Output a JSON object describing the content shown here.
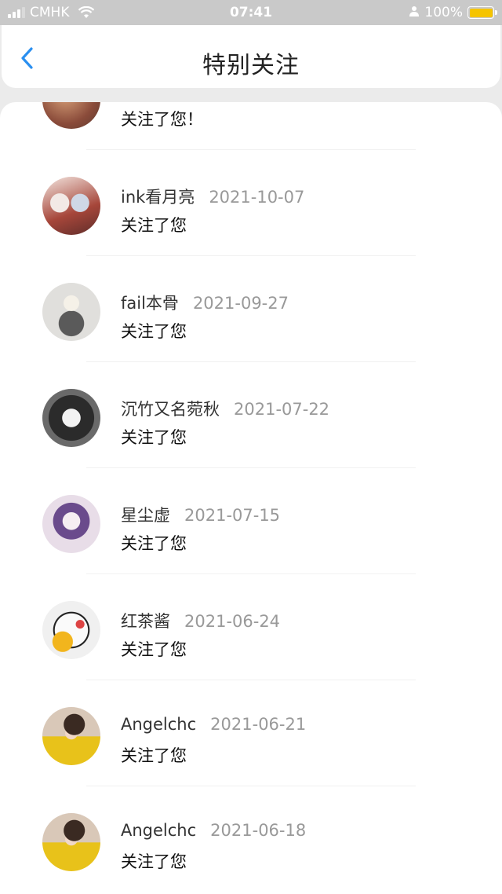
{
  "status_bar": {
    "carrier": "CMHK",
    "time": "07:41",
    "battery": "100%",
    "battery_color": "#f5c400"
  },
  "header": {
    "title": "特别关注",
    "back_icon": "chevron-left-icon",
    "accent": "#2a8ff0"
  },
  "list": [
    {
      "name": "",
      "date": "",
      "message": "关注了您！"
    },
    {
      "name": "ink看月亮",
      "date": "2021-10-07",
      "message": "关注了您"
    },
    {
      "name": "fail本骨",
      "date": "2021-09-27",
      "message": "关注了您"
    },
    {
      "name": "沉竹又名菀秋",
      "date": "2021-07-22",
      "message": "关注了您"
    },
    {
      "name": "星尘虚",
      "date": "2021-07-15",
      "message": "关注了您"
    },
    {
      "name": "红茶酱",
      "date": "2021-06-24",
      "message": "关注了您"
    },
    {
      "name": "Angelchc",
      "date": "2021-06-21",
      "message": "关注了您"
    },
    {
      "name": "Angelchc",
      "date": "2021-06-18",
      "message": "关注了您"
    }
  ]
}
